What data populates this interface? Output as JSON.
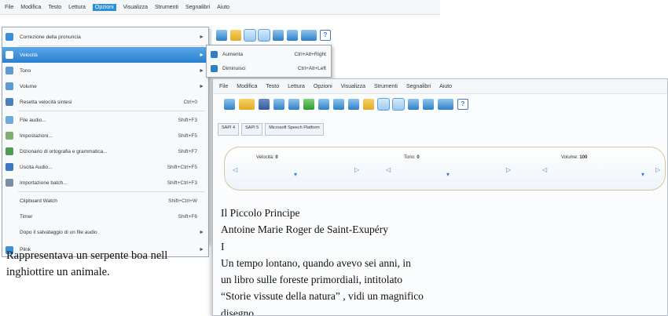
{
  "back_window": {
    "menubar": [
      "File",
      "Modifica",
      "Testo",
      "Lettura",
      "Opzioni",
      "Visualizza",
      "Strumenti",
      "Segnalibri",
      "Aiuto"
    ],
    "dropdown": [
      {
        "label": "Correzione della pronuncia",
        "shortcut": "",
        "arrow": "►",
        "icon": "#3a8fd8"
      },
      {
        "label": "Velocità",
        "shortcut": "",
        "arrow": "►",
        "icon": "#3a8fd8",
        "active": true
      },
      {
        "label": "Tono",
        "shortcut": "",
        "arrow": "►",
        "icon": "#5b9bd5"
      },
      {
        "label": "Volume",
        "shortcut": "",
        "arrow": "►",
        "icon": "#5b9bd5"
      },
      {
        "label": "Resetta velocità sintesi",
        "shortcut": "Ctrl+0",
        "arrow": "",
        "icon": "#4a7fc2"
      },
      {
        "label": "File audio...",
        "shortcut": "Shift+F3",
        "arrow": "",
        "icon": "#6fa9e0"
      },
      {
        "label": "Impostazioni...",
        "shortcut": "Shift+F5",
        "arrow": "",
        "icon": "#7fb06a"
      },
      {
        "label": "Dizionario di ortografia e grammatica...",
        "shortcut": "Shift+F7",
        "arrow": "",
        "icon": "#4f9d55"
      },
      {
        "label": "Uscita Audio...",
        "shortcut": "Shift+Ctrl+F5",
        "arrow": "",
        "icon": "#3a78c2"
      },
      {
        "label": "Importazione batch...",
        "shortcut": "Shift+Ctrl+F3",
        "arrow": "",
        "icon": "#7a8da3"
      },
      {
        "label": "Clipboard Watch",
        "shortcut": "Shift+Ctrl+W",
        "arrow": "",
        "icon": ""
      },
      {
        "label": "Timer",
        "shortcut": "Shift+F6",
        "arrow": "",
        "icon": ""
      },
      {
        "label": "Dopo il salvataggio di un file audio",
        "shortcut": "",
        "arrow": "►",
        "icon": ""
      },
      {
        "label": "Plink",
        "shortcut": "",
        "arrow": "►",
        "icon": "#3a8fd8"
      }
    ],
    "submenu": [
      {
        "label": "Aumenta",
        "shortcut": "Ctrl+Alt+Right"
      },
      {
        "label": "Diminuisci",
        "shortcut": "Ctrl+Alt+Left"
      }
    ],
    "doc_lines": [
      "Rappresentava un serpente boa nell",
      "inghiottire un animale."
    ]
  },
  "front_window": {
    "menubar": [
      "File",
      "Modifica",
      "Testo",
      "Lettura",
      "Opzioni",
      "Visualizza",
      "Strumenti",
      "Segnalibri",
      "Aiuto"
    ],
    "tabs": [
      "SAPI 4",
      "SAPI 5",
      "Microsoft Speech Platform"
    ],
    "sliders": [
      {
        "label": "Velocità:",
        "value": "0"
      },
      {
        "label": "Tono:",
        "value": "0"
      },
      {
        "label": "Volume:",
        "value": "100"
      }
    ],
    "doc_lines": [
      "Il Piccolo Principe",
      "Antoine Marie Roger de Saint-Exupéry",
      "I",
      "Un tempo lontano, quando avevo sei anni, in",
      "un libro sulle foreste primordiali, intitolato",
      "“Storie vissute della natura” , vidi un magnifico",
      "disegno."
    ]
  }
}
